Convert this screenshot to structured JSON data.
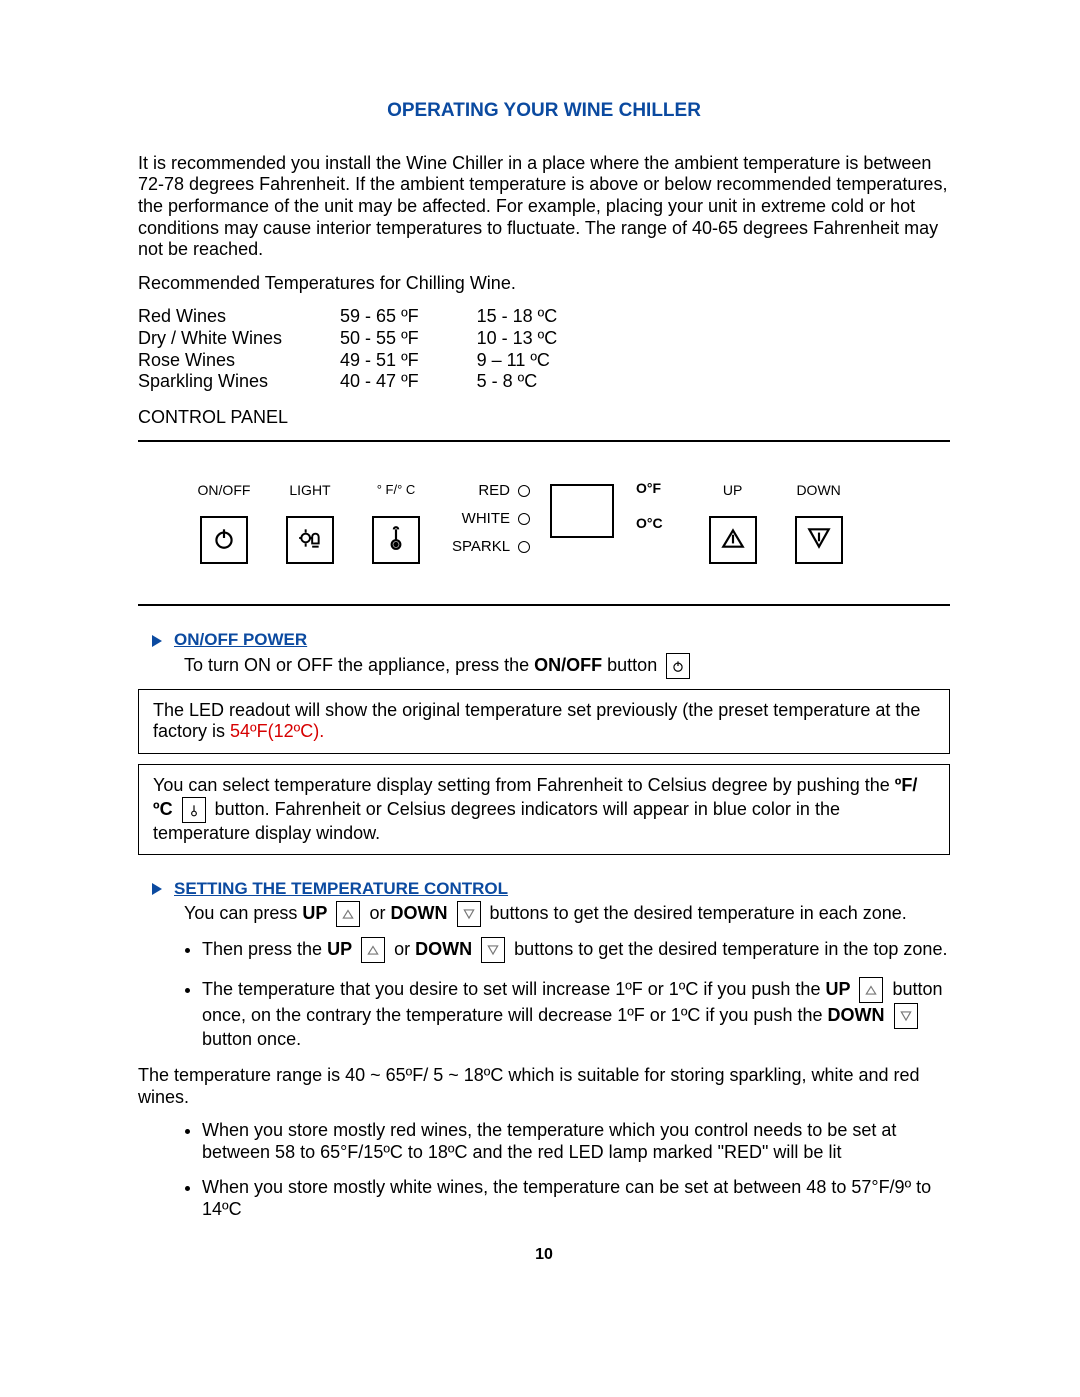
{
  "title": "OPERATING YOUR WINE CHILLER",
  "intro": "It is recommended you install the Wine Chiller in a place where the ambient temperature is between 72-78 degrees Fahrenheit.  If the ambient temperature is above or below recommended temperatures, the performance of the unit may be affected.  For example, placing your unit in extreme cold or hot conditions may cause interior temperatures to fluctuate.  The range of 40-65 degrees Fahrenheit may not be reached.",
  "recommend_label": "Recommended Temperatures for Chilling Wine.",
  "temp_rows": {
    "r1": {
      "name": "Red Wines",
      "f": "59 - 65 ºF",
      "c": "15 - 18 ºC"
    },
    "r2": {
      "name": "Dry / White Wines",
      "f": "50 - 55 ºF",
      "c": "10 - 13 ºC"
    },
    "r3": {
      "name": "Rose Wines",
      "f": "49 - 51 ºF",
      "c": "9 – 11 ºC"
    },
    "r4": {
      "name": "Sparkling Wines",
      "f": "40 - 47 ºF",
      "c": "5 - 8 ºC"
    }
  },
  "control_panel_label": "CONTROL PANEL",
  "panel": {
    "onoff": "ON/OFF",
    "light": "LIGHT",
    "fc": "° F/° C",
    "red": "RED",
    "white": "WHITE",
    "sparkl": "SPARKL",
    "of": "O°F",
    "oc": "O°C",
    "up": "UP",
    "down": "DOWN"
  },
  "onoff_heading": "ON/OFF POWER",
  "onoff_text_pre": "To turn ON or OFF the appliance, press the ",
  "onoff_bold": "ON/OFF",
  "onoff_text_post": " button",
  "box1_pre": "The LED readout will show the original temperature set previously (the preset temperature at the factory is ",
  "box1_red": "54ºF(12ºC).",
  "box2_pre": "You can select temperature display setting from Fahrenheit to Celsius degree by pushing the ",
  "box2_bold": "ºF/ºC",
  "box2_post": "  button.  Fahrenheit or Celsius degrees indicators will appear in blue color in the temperature display window.",
  "set_heading": "SETTING THE TEMPERATURE CONTROL",
  "set_line_pre": "You can press ",
  "set_up": "UP",
  "set_or": "  or ",
  "set_down": "DOWN",
  "set_line_post": " buttons to get the desired temperature in each zone.",
  "b1_pre": "Then press the ",
  "b1_post": " buttons to get the desired temperature in the top zone.",
  "b2_pre": "The temperature that you desire to set will increase 1ºF or 1ºC if you push the ",
  "b2_mid": " button once, on the contrary the temperature will decrease 1ºF or 1ºC if you push the ",
  "b2_post": " button once.",
  "range": "The temperature range is 40 ~ 65ºF/ 5 ~ 18ºC which is suitable for storing sparkling, white and red wines.",
  "r_bullet1": "When you store mostly red wines, the temperature which you control needs to be set at between 58 to 65°F/15ºC to 18ºC and the red LED lamp marked \"RED\" will be lit",
  "r_bullet2": "When you store mostly white wines, the temperature can be set at between 48 to 57°F/9º to 14ºC",
  "page_number": "10"
}
